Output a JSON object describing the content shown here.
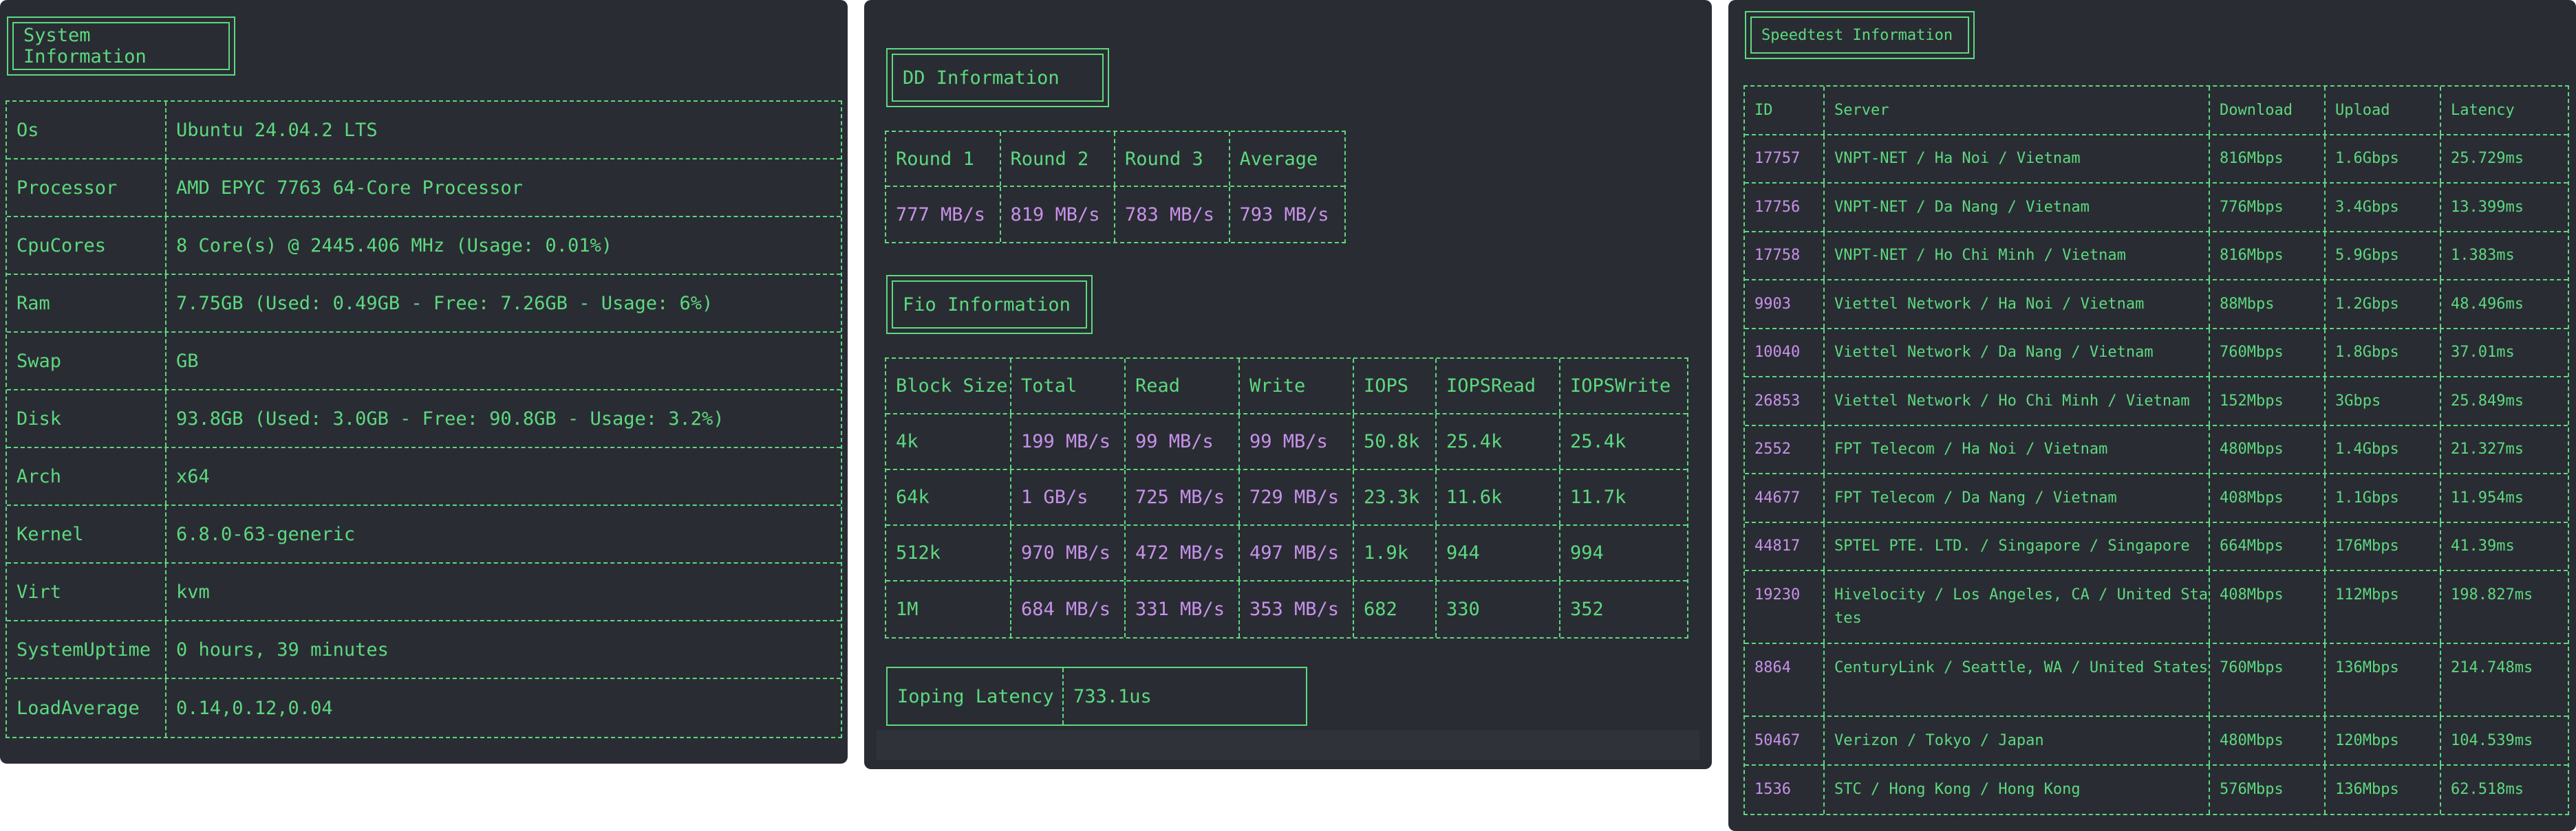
{
  "system": {
    "title": "System Information",
    "rows": [
      {
        "label": "Os",
        "value": "Ubuntu 24.04.2 LTS"
      },
      {
        "label": "Processor",
        "value": "AMD EPYC 7763 64-Core Processor"
      },
      {
        "label": "CpuCores",
        "value": "8 Core(s) @ 2445.406 MHz (Usage: 0.01%)"
      },
      {
        "label": "Ram",
        "value": "7.75GB (Used: 0.49GB - Free: 7.26GB - Usage: 6%)"
      },
      {
        "label": "Swap",
        "value": "GB"
      },
      {
        "label": "Disk",
        "value": "93.8GB (Used: 3.0GB - Free: 90.8GB - Usage: 3.2%)"
      },
      {
        "label": "Arch",
        "value": "x64"
      },
      {
        "label": "Kernel",
        "value": "6.8.0-63-generic"
      },
      {
        "label": "Virt",
        "value": "kvm"
      },
      {
        "label": "SystemUptime",
        "value": "0 hours, 39 minutes"
      },
      {
        "label": "LoadAverage",
        "value": "0.14,0.12,0.04"
      }
    ]
  },
  "dd": {
    "title": "DD Information",
    "headers": [
      "Round 1",
      "Round 2",
      "Round 3",
      "Average"
    ],
    "values": [
      "777 MB/s",
      "819 MB/s",
      "783 MB/s",
      "793 MB/s"
    ]
  },
  "fio": {
    "title": "Fio Information",
    "headers": [
      "Block Size",
      "Total",
      "Read",
      "Write",
      "IOPS",
      "IOPSRead",
      "IOPSWrite"
    ],
    "rows": [
      [
        "4k",
        "199 MB/s",
        "99 MB/s",
        "99 MB/s",
        "50.8k",
        "25.4k",
        "25.4k"
      ],
      [
        "64k",
        "1 GB/s",
        "725 MB/s",
        "729 MB/s",
        "23.3k",
        "11.6k",
        "11.7k"
      ],
      [
        "512k",
        "970 MB/s",
        "472 MB/s",
        "497 MB/s",
        "1.9k",
        "944",
        "994"
      ],
      [
        "1M",
        "684 MB/s",
        "331 MB/s",
        "353 MB/s",
        "682",
        "330",
        "352"
      ]
    ]
  },
  "ioping": {
    "label": "Ioping Latency",
    "value": "733.1us"
  },
  "speedtest": {
    "title": "Speedtest Information",
    "headers": [
      "ID",
      "Server",
      "Download",
      "Upload",
      "Latency"
    ],
    "rows": [
      [
        "17757",
        "VNPT-NET / Ha Noi / Vietnam",
        "816Mbps",
        "1.6Gbps",
        "25.729ms"
      ],
      [
        "17756",
        "VNPT-NET / Da Nang / Vietnam",
        "776Mbps",
        "3.4Gbps",
        "13.399ms"
      ],
      [
        "17758",
        "VNPT-NET / Ho Chi Minh / Vietnam",
        "816Mbps",
        "5.9Gbps",
        "1.383ms"
      ],
      [
        "9903",
        "Viettel Network / Ha Noi / Vietnam",
        "88Mbps",
        "1.2Gbps",
        "48.496ms"
      ],
      [
        "10040",
        "Viettel Network / Da Nang / Vietnam",
        "760Mbps",
        "1.8Gbps",
        "37.01ms"
      ],
      [
        "26853",
        "Viettel Network / Ho Chi Minh / Vietnam",
        "152Mbps",
        "3Gbps",
        "25.849ms"
      ],
      [
        "2552",
        "FPT Telecom / Ha Noi / Vietnam",
        "480Mbps",
        "1.4Gbps",
        "21.327ms"
      ],
      [
        "44677",
        "FPT Telecom / Da Nang / Vietnam",
        "408Mbps",
        "1.1Gbps",
        "11.954ms"
      ],
      [
        "44817",
        "SPTEL PTE. LTD. / Singapore / Singapore",
        "664Mbps",
        "176Mbps",
        "41.39ms"
      ],
      [
        "19230",
        "Hivelocity / Los Angeles, CA / United States",
        "408Mbps",
        "112Mbps",
        "198.827ms"
      ],
      [
        "8864",
        "CenturyLink / Seattle, WA / United States",
        "760Mbps",
        "136Mbps",
        "214.748ms"
      ],
      [
        "50467",
        "Verizon / Tokyo / Japan",
        "480Mbps",
        "120Mbps",
        "104.539ms"
      ],
      [
        "1536",
        "STC / Hong Kong / Hong Kong",
        "576Mbps",
        "136Mbps",
        "62.518ms"
      ]
    ]
  },
  "colors": {
    "panel": "#2a2c33",
    "text": "#5cd97f",
    "number": "#c792ea"
  }
}
